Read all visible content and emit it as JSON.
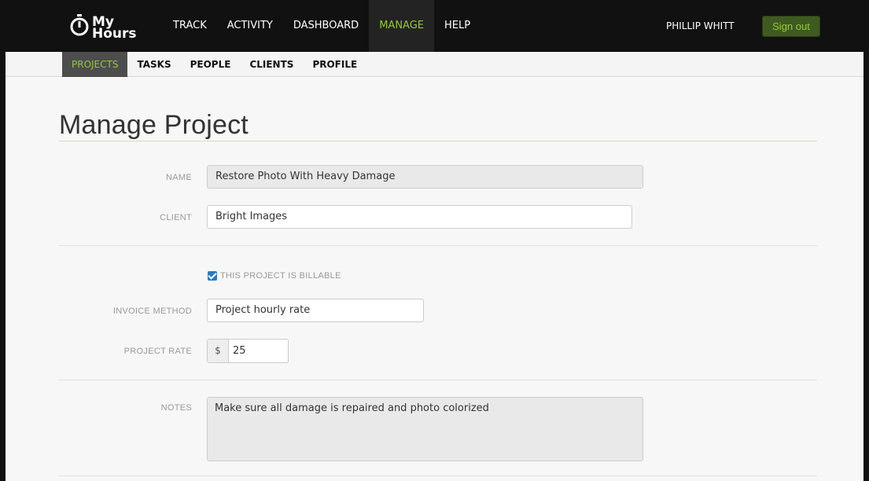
{
  "app": {
    "logo_line1": "My",
    "logo_line2": "Hours"
  },
  "topnav": {
    "items": [
      {
        "label": "TRACK"
      },
      {
        "label": "ACTIVITY"
      },
      {
        "label": "DASHBOARD"
      },
      {
        "label": "MANAGE"
      },
      {
        "label": "HELP"
      }
    ],
    "active": "MANAGE",
    "user_name": "PHILLIP WHITT",
    "signout_label": "Sign out"
  },
  "subnav": {
    "items": [
      {
        "label": "PROJECTS"
      },
      {
        "label": "TASKS"
      },
      {
        "label": "PEOPLE"
      },
      {
        "label": "CLIENTS"
      },
      {
        "label": "PROFILE"
      }
    ],
    "active": "PROJECTS"
  },
  "page": {
    "title": "Manage Project"
  },
  "form": {
    "name_label": "NAME",
    "name_value": "Restore Photo With Heavy Damage",
    "client_label": "CLIENT",
    "client_value": "Bright Images",
    "billable_checked": true,
    "billable_label": "THIS PROJECT IS BILLABLE",
    "invoice_method_label": "INVOICE METHOD",
    "invoice_method_value": "Project hourly rate",
    "project_rate_label": "PROJECT RATE",
    "currency_symbol": "$",
    "project_rate_value": "25",
    "notes_label": "NOTES",
    "notes_value": "Make sure all damage is repaired and photo colorized"
  },
  "colors": {
    "accent_green": "#94c83d",
    "topbar_bg": "#111111",
    "checkbox_blue": "#2a7bbf"
  }
}
